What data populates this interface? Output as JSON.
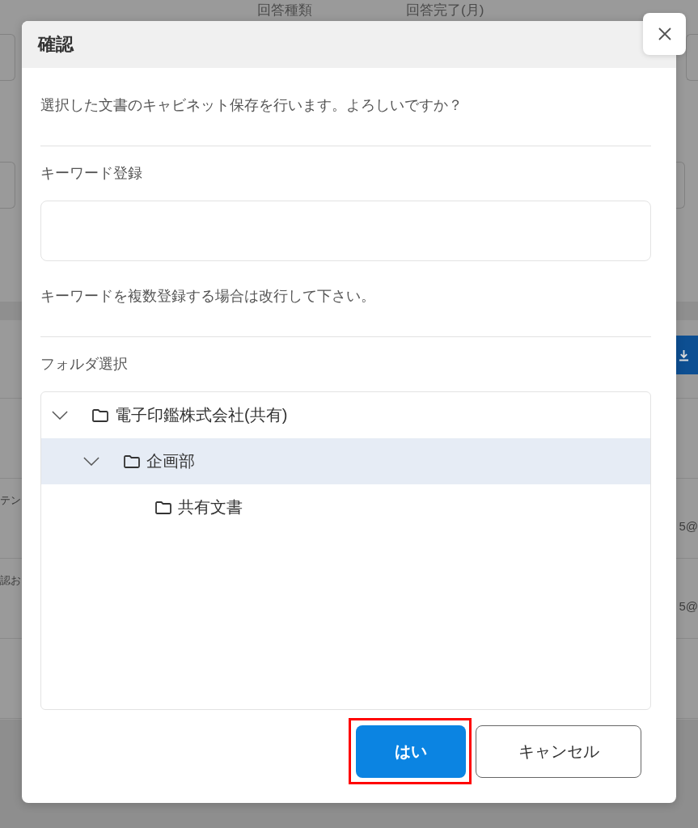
{
  "background_page": {
    "column_headers": [
      "回答種類",
      "回答完了(月)"
    ],
    "rows": [
      {
        "cells": [
          "テン",
          "5@"
        ]
      },
      {
        "cells": [
          "認お",
          "5@"
        ]
      }
    ]
  },
  "dialog": {
    "title": "確認",
    "message": "選択した文書のキャビネット保存を行います。よろしいですか？",
    "keyword": {
      "label": "キーワード登録",
      "hint": "キーワードを複数登録する場合は改行して下さい。"
    },
    "folder": {
      "label": "フォルダ選択",
      "tree": [
        {
          "label": "電子印鑑株式会社(共有)",
          "expanded": true,
          "selected": false,
          "children": [
            {
              "label": "企画部",
              "expanded": true,
              "selected": true,
              "children": [
                {
                  "label": "共有文書",
                  "selected": false
                }
              ]
            }
          ]
        }
      ]
    },
    "buttons": [
      {
        "label": "はい",
        "kind": "primary",
        "highlighted": true
      },
      {
        "label": "キャンセル",
        "kind": "secondary",
        "highlighted": false
      }
    ]
  }
}
